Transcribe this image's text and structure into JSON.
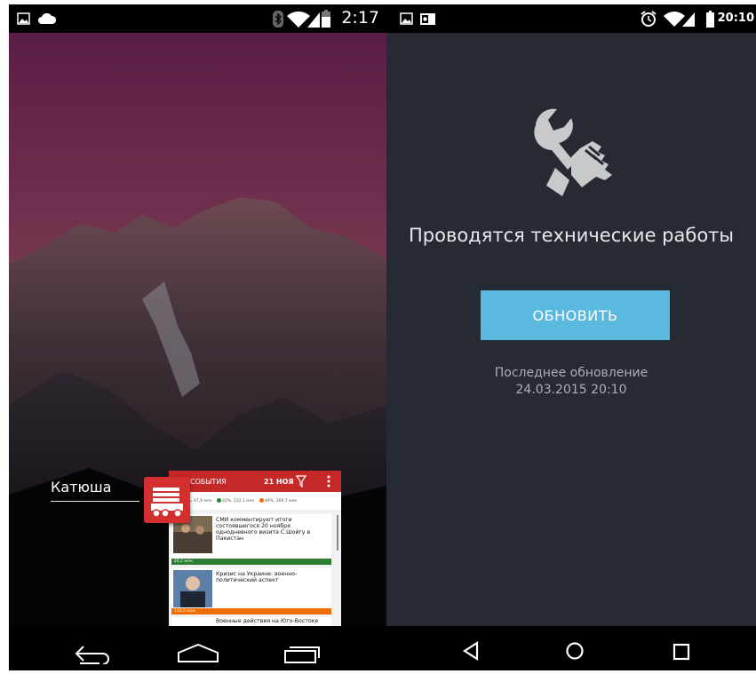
{
  "left_screen": {
    "status_bar": {
      "time": "2:17",
      "left_icons": [
        "image-icon",
        "cloud-icon"
      ],
      "right_icons": [
        "bluetooth-icon",
        "wifi-icon",
        "signal-icon",
        "battery-icon"
      ]
    },
    "home": {
      "app_label": "Катюша"
    },
    "recent_app_card": {
      "header_title": "СОБЫТИЯ",
      "header_date": "21 НОЯ",
      "legend": [
        {
          "color": "#c62828",
          "text": "9%, 47,9 млн"
        },
        {
          "color": "#2e7d32",
          "text": "42%, 232,1 млн"
        },
        {
          "color": "#ef6c00",
          "text": "49%, 269,7 млн"
        }
      ],
      "news": [
        {
          "headline": "СМИ комментируют итоги состоявшегося 20 ноября однодневного визита С.Шойгу в Пакистан",
          "stat": "26,2 млн",
          "bar_color": "#2e7d32"
        },
        {
          "headline": "Кризис на Украине: военно-политический аспект",
          "stat": "103,4 млн",
          "bar_color": "#ef6c00"
        },
        {
          "headline": "Военные действия на Юго-Востоке",
          "stat": "",
          "bar_color": "#ef6c00"
        }
      ]
    },
    "nav_bar": [
      "back-icon",
      "home-icon",
      "recents-icon"
    ]
  },
  "right_screen": {
    "status_bar": {
      "time": "20:10",
      "left_icons": [
        "image-icon",
        "outlook-icon"
      ],
      "right_icons": [
        "alarm-icon",
        "wifi-icon",
        "signal-icon",
        "battery-icon"
      ]
    },
    "maintenance": {
      "icon": "tools-icon",
      "title": "Проводятся технические работы",
      "button_label": "ОБНОВИТЬ",
      "last_update_label": "Последнее обновление",
      "last_update_date": "24.03.2015 20:10"
    },
    "nav_bar": [
      "back-icon",
      "home-icon",
      "recents-icon"
    ],
    "colors": {
      "background": "#262b33",
      "button": "#5bb8de"
    }
  }
}
